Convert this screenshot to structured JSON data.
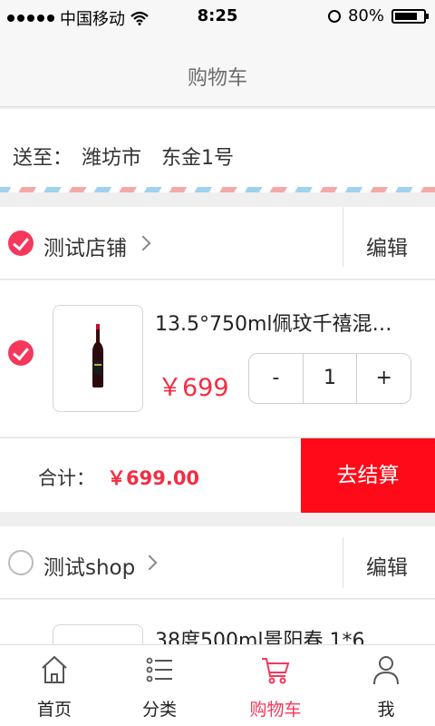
{
  "status_bar": {
    "carrier": "中国移动",
    "time": "8:25",
    "battery": "80%",
    "battery_level": 0.8
  },
  "nav": {
    "title": "购物车"
  },
  "address": {
    "label": "送至：",
    "city": "潍坊市",
    "street": "东金1号"
  },
  "stores": [
    {
      "name": "测试店铺",
      "checked": true,
      "edit_label": "编辑",
      "item": {
        "title": "13.5°750ml佩玟千禧混…",
        "price": "￥699",
        "quantity": "1",
        "minus": "-",
        "plus": "+"
      },
      "total_label": "合计：",
      "total_amount": "￥699.00",
      "checkout_label": "去结算"
    },
    {
      "name": "测试shop",
      "checked": false,
      "edit_label": "编辑",
      "item": {
        "title": "38度500ml景阳春 1*6"
      }
    }
  ],
  "tabs": [
    {
      "label": "首页",
      "icon": "home-icon"
    },
    {
      "label": "分类",
      "icon": "list-icon"
    },
    {
      "label": "购物车",
      "icon": "cart-icon",
      "active": true
    },
    {
      "label": "我",
      "icon": "person-icon"
    }
  ],
  "colors": {
    "accent": "#f5385b",
    "checkout": "#ff0a18",
    "price": "#f32d43"
  }
}
